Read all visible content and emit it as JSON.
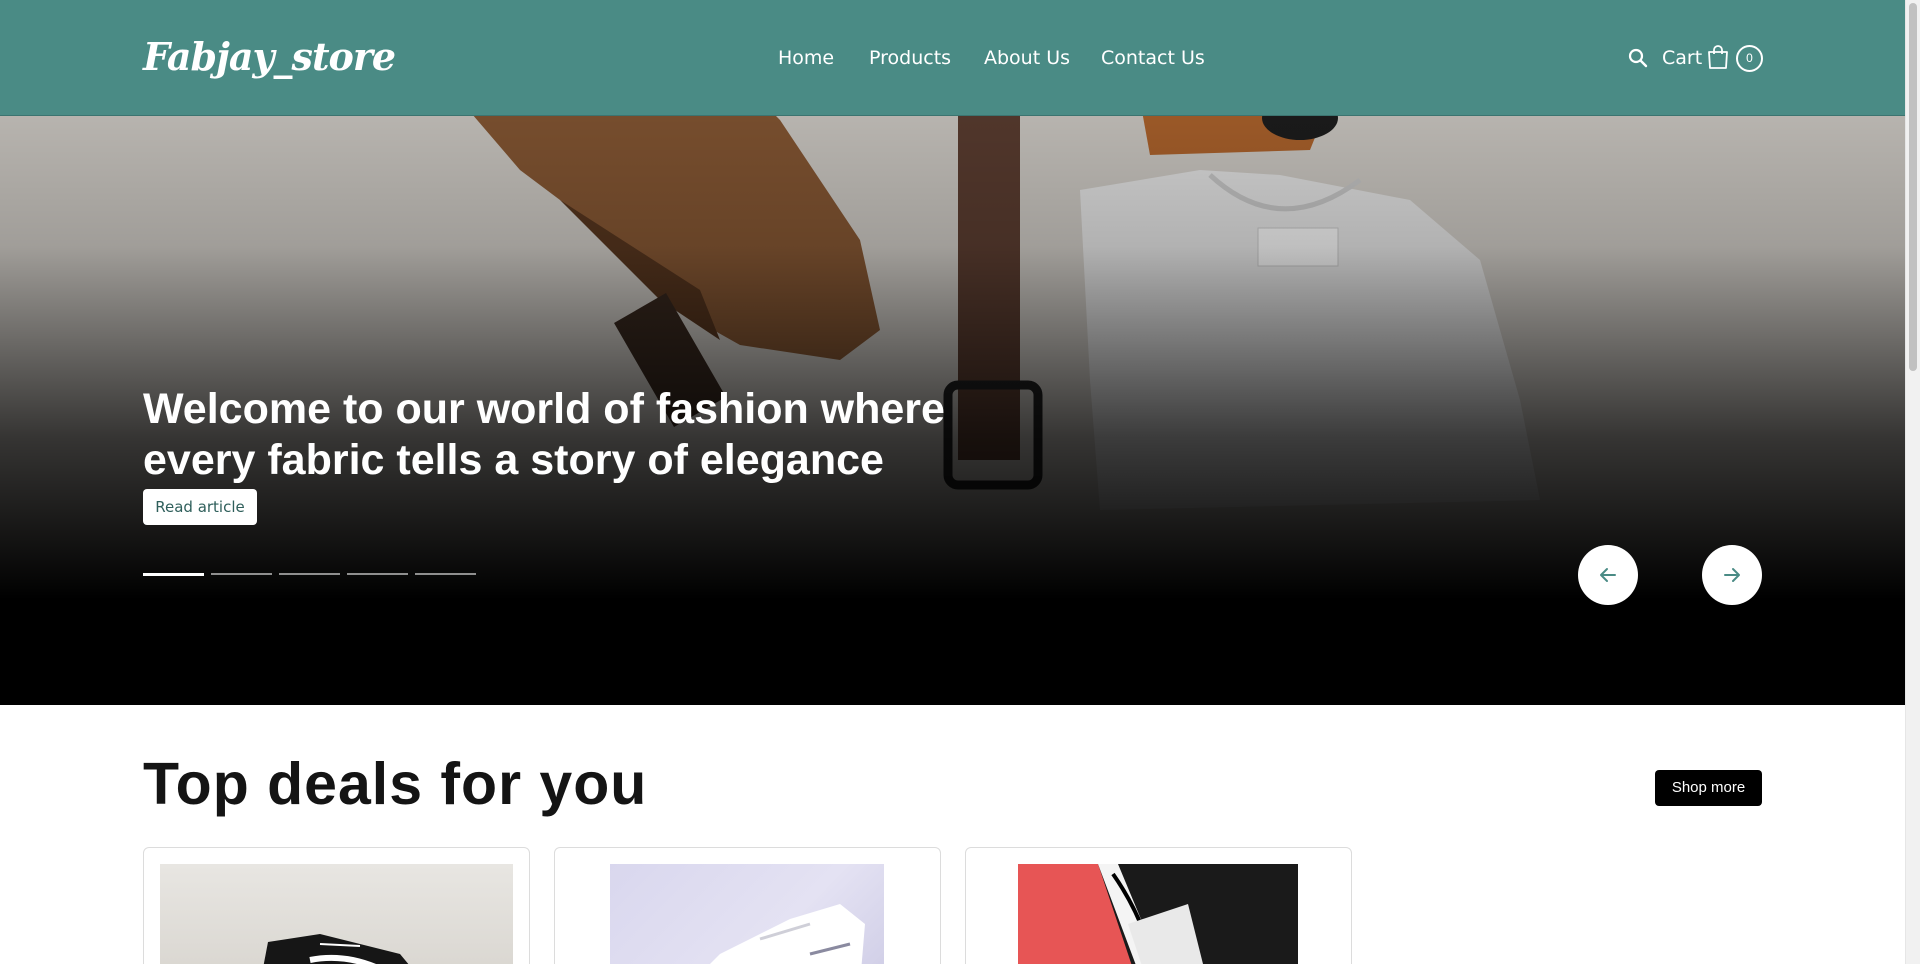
{
  "header": {
    "logo": "Fabjay_store",
    "nav": [
      "Home",
      "Products",
      "About Us",
      "Contact Us"
    ],
    "cart_label": "Cart",
    "cart_count": "0",
    "icons": {
      "search": "search-icon",
      "cart": "shopping-bag-icon"
    },
    "background": "#4a8b85"
  },
  "hero": {
    "title": "Welcome to our world of fashion where every fabric tells a story of elegance",
    "cta": "Read article",
    "slides_total": 5,
    "active_slide": 1,
    "prev_icon": "arrow-left-icon",
    "next_icon": "arrow-right-icon"
  },
  "deals": {
    "title": "Top deals for you",
    "shop_more": "Shop more",
    "cards": [
      {
        "image": "black sneakers photo"
      },
      {
        "image": "white sneaker on lavender background"
      },
      {
        "image": "sneaker on red and black background"
      }
    ]
  }
}
